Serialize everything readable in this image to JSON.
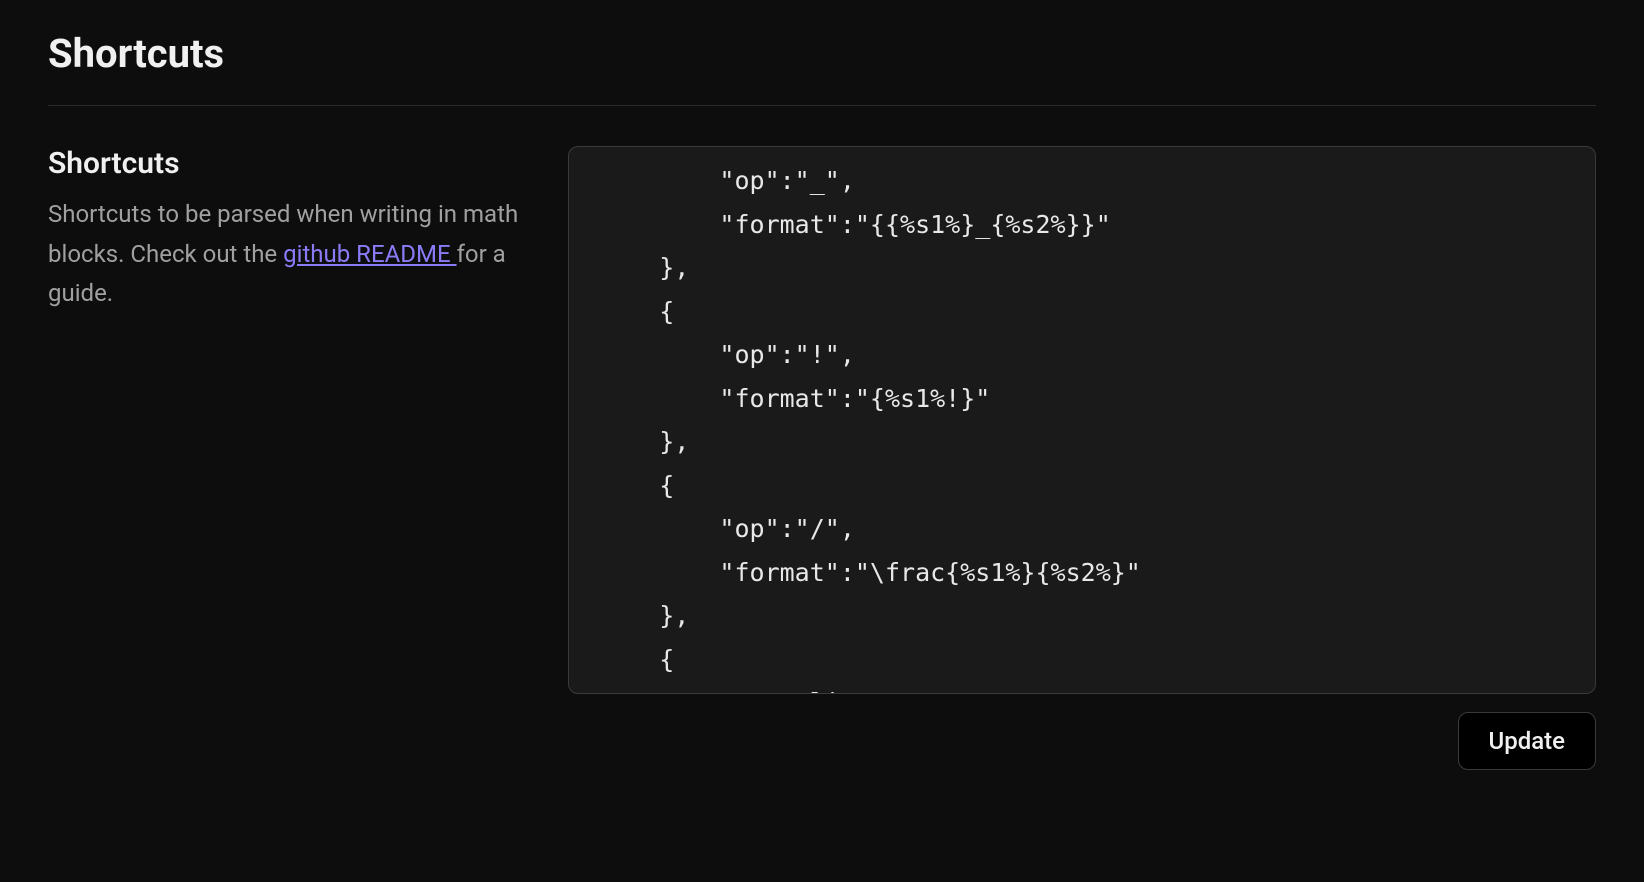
{
  "page": {
    "title": "Shortcuts"
  },
  "section": {
    "heading": "Shortcuts",
    "desc_prefix": "Shortcuts to be parsed when writing in math blocks. Check out the ",
    "link_text": "github README ",
    "desc_suffix": "for a guide."
  },
  "editor": {
    "content": "        \"op\":\"_\",\n        \"format\":\"{{%s1%}_{%s2%}}\"\n    },\n    {\n        \"op\":\"!\",\n        \"format\":\"{%s1%!}\"\n    },\n    {\n        \"op\":\"/\",\n        \"format\":\"\\frac{%s1%}{%s2%}\"\n    },\n    {\n        \"op\":\"lim\","
  },
  "actions": {
    "update_label": "Update"
  }
}
